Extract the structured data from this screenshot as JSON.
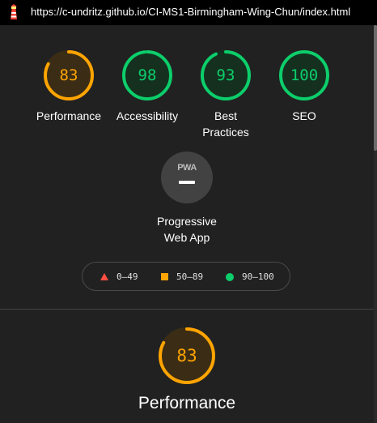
{
  "topbar": {
    "url": "https://c-undritz.github.io/CI-MS1-Birmingham-Wing-Chun/index.html",
    "icon": "lighthouse-icon"
  },
  "colors": {
    "average": "#ffa400",
    "pass": "#0cce6b",
    "fail": "#ff4e42"
  },
  "gauges": [
    {
      "score": "83",
      "label": "Performance",
      "status": "average",
      "fraction": 0.83
    },
    {
      "score": "98",
      "label": "Accessibility",
      "status": "pass",
      "fraction": 0.98
    },
    {
      "score": "93",
      "label_line1": "Best",
      "label_line2": "Practices",
      "status": "pass",
      "fraction": 0.93
    },
    {
      "score": "100",
      "label": "SEO",
      "status": "pass",
      "fraction": 1.0
    }
  ],
  "pwa": {
    "badge": "PWA",
    "label_line1": "Progressive",
    "label_line2": "Web App"
  },
  "legend": {
    "fail": "0–49",
    "average": "50–89",
    "pass": "90–100"
  },
  "section": {
    "score": "83",
    "fraction": 0.83,
    "title": "Performance"
  }
}
